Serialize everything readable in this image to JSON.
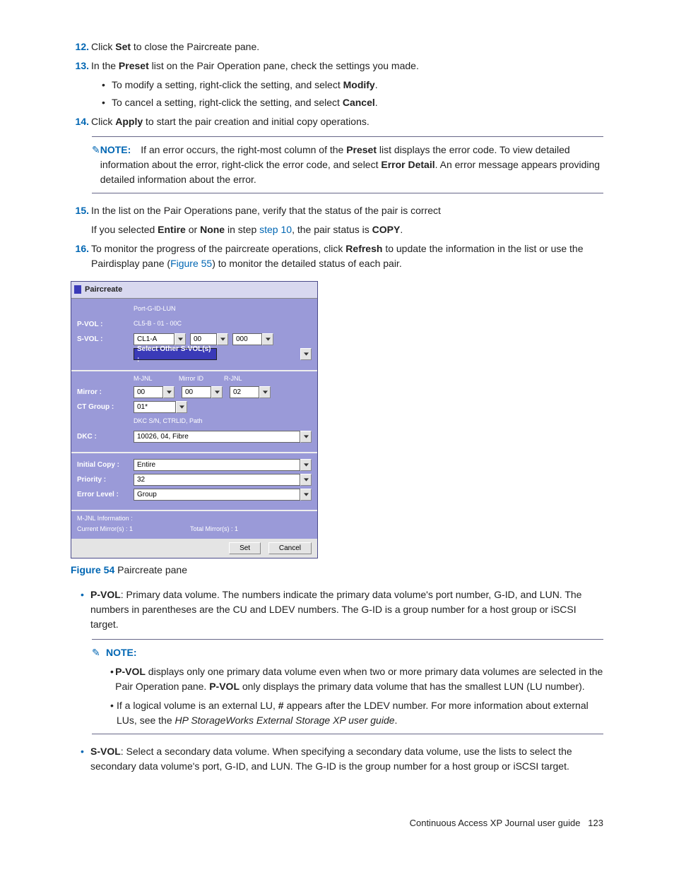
{
  "steps": {
    "s12": {
      "num": "12.",
      "txt_a": "Click ",
      "b1": "Set",
      "txt_b": " to close the Paircreate pane."
    },
    "s13": {
      "num": "13.",
      "txt_a": "In the ",
      "b1": "Preset",
      "txt_b": " list on the Pair Operation pane, check the settings you made."
    },
    "s13a": {
      "txt_a": "To modify a setting, right-click the setting, and select ",
      "b1": "Modify",
      "txt_b": "."
    },
    "s13b": {
      "txt_a": "To cancel a setting, right-click the setting, and select ",
      "b1": "Cancel",
      "txt_b": "."
    },
    "s14": {
      "num": "14.",
      "txt_a": "Click ",
      "b1": "Apply",
      "txt_b": " to start the pair creation and initial copy operations."
    },
    "s15": {
      "num": "15.",
      "txt": "In the list on the Pair Operations pane, verify that the status of the pair is correct"
    },
    "s15b": {
      "txt_a": "If you selected ",
      "b1": "Entire",
      "txt_b": " or ",
      "b2": "None",
      "txt_c": " in step ",
      "link": "step 10",
      "txt_d": ", the pair status is ",
      "b3": "COPY",
      "txt_e": "."
    },
    "s16": {
      "num": "16.",
      "txt_a": "To monitor the progress of the paircreate operations, click ",
      "b1": "Refresh",
      "txt_b": " to update the information in the list or use the Pairdisplay pane (",
      "link": "Figure 55",
      "txt_c": ") to monitor the detailed status of each pair."
    }
  },
  "note1": {
    "label": "NOTE:",
    "txt_a": "If an error occurs, the right-most column of the ",
    "b1": "Preset",
    "txt_b": " list displays the error code. To view detailed information about the error, right-click the error code, and select ",
    "b2": "Error Detail",
    "txt_c": ". An error message appears providing detailed information about the error."
  },
  "figure": {
    "title": "Paircreate",
    "header_pgl": "Port-G-ID-LUN",
    "pvol_lab": "P-VOL :",
    "pvol_val": "CL5-B - 01 - 00C",
    "svol_lab": "S-VOL :",
    "svol_v1": "CL1-A",
    "svol_v2": "00",
    "svol_v3": "000",
    "svol_other": "Select Other S-VOL(s) :",
    "mh1": "M-JNL",
    "mh2": "Mirror ID",
    "mh3": "R-JNL",
    "mirror_lab": "Mirror :",
    "m1": "00",
    "m2": "00",
    "m3": "02",
    "ct_lab": "CT Group :",
    "ct_val": "01*",
    "dkc_sub": "DKC S/N, CTRLID, Path",
    "dkc_lab": "DKC :",
    "dkc_val": "10026, 04, Fibre",
    "init_lab": "Initial Copy :",
    "init_val": "Entire",
    "prio_lab": "Priority :",
    "prio_val": "32",
    "err_lab": "Error Level :",
    "err_val": "Group",
    "info_a": "M-JNL Information :",
    "info_b": "Current Mirror(s) :   1",
    "info_c": "Total Mirror(s) :   1",
    "btn_set": "Set",
    "btn_cancel": "Cancel"
  },
  "caption": {
    "label": "Figure 54",
    "txt": " Paircreate pane"
  },
  "pvol_desc": {
    "b1": "P-VOL",
    "txt": ": Primary data volume. The numbers indicate the primary data volume's port number, G-ID, and LUN. The numbers in parentheses are the CU and LDEV numbers. The G-ID is a group number for a host group or iSCSI target."
  },
  "note2": {
    "label": "NOTE:",
    "a": {
      "b1": "P-VOL",
      "txt_a": " displays only one primary data volume even when two or more primary data volumes are selected in the Pair Operation pane. ",
      "b2": "P-VOL",
      "txt_b": " only displays the primary data volume that has the smallest LUN (LU number)."
    },
    "b": {
      "txt_a": "If a logical volume is an external LU, ",
      "b1": "#",
      "txt_b": " appears after the LDEV number. For more information about external LUs, see the ",
      "i1": "HP StorageWorks External Storage XP user guide",
      "txt_c": "."
    }
  },
  "svol_desc": {
    "b1": "S-VOL",
    "txt": ": Select a secondary data volume. When specifying a secondary data volume, use the lists to select the secondary data volume's port, G-ID, and LUN. The G-ID is the group number for a host group or iSCSI target."
  },
  "footer": {
    "title": "Continuous Access XP Journal user guide",
    "page": "123"
  }
}
